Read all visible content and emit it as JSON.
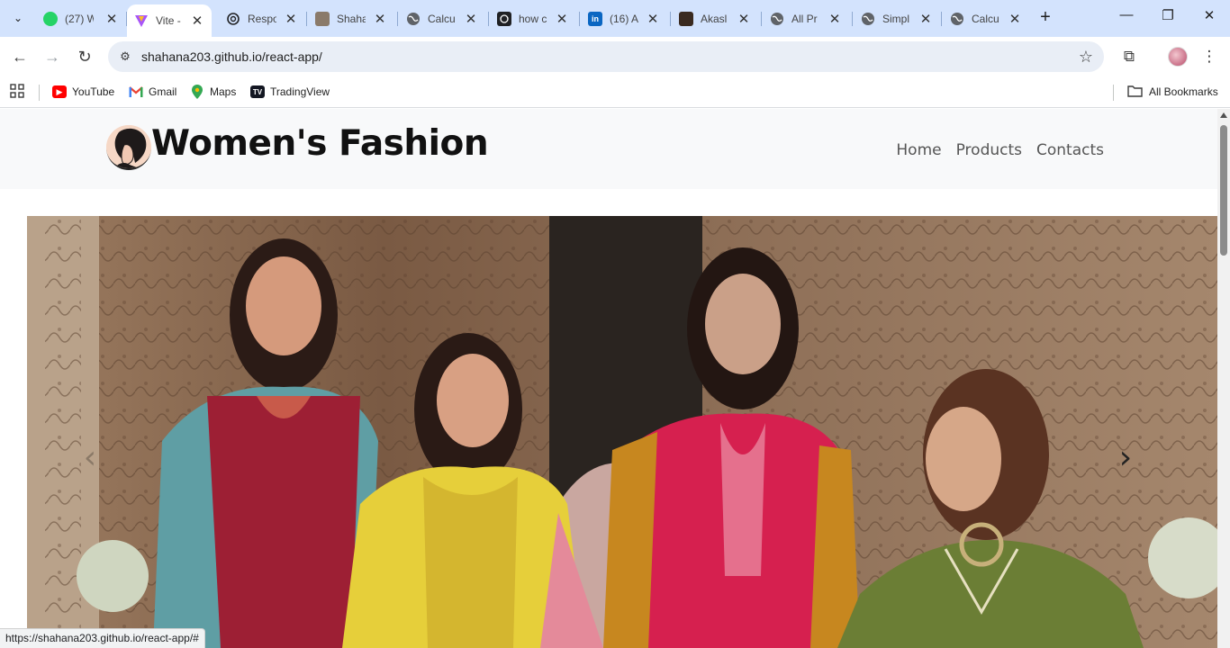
{
  "browser": {
    "tabs": [
      {
        "title": "(27) W",
        "icon": "whatsapp-icon",
        "color": "#25d366",
        "badge": "27"
      },
      {
        "title": "Vite -",
        "icon": "vite-icon",
        "color": "#a855f7",
        "active": true
      },
      {
        "title": "Respo",
        "icon": "openai-icon",
        "color": "#202124"
      },
      {
        "title": "Shaha",
        "icon": "github-avatar-icon",
        "color": "#8a7a6a"
      },
      {
        "title": "Calcu",
        "icon": "globe-icon",
        "color": "#5f6368"
      },
      {
        "title": "how c",
        "icon": "github-icon",
        "color": "#202124"
      },
      {
        "title": "(16) A",
        "icon": "linkedin-icon",
        "color": "#0a66c2",
        "badge": "in"
      },
      {
        "title": "Akasl",
        "icon": "profile-icon",
        "color": "#3a2a20"
      },
      {
        "title": "All Pr",
        "icon": "globe-icon",
        "color": "#5f6368"
      },
      {
        "title": "Simpl",
        "icon": "globe-icon",
        "color": "#5f6368"
      },
      {
        "title": "Calcu",
        "icon": "globe-icon",
        "color": "#5f6368"
      }
    ],
    "url": "shahana203.github.io/react-app/",
    "bookmarks": [
      {
        "label": "YouTube",
        "icon": "youtube-icon",
        "color": "#ff0000"
      },
      {
        "label": "Gmail",
        "icon": "gmail-icon",
        "color": "#ea4335"
      },
      {
        "label": "Maps",
        "icon": "maps-pin-icon",
        "color": "#34a853"
      },
      {
        "label": "TradingView",
        "icon": "tradingview-icon",
        "color": "#131722"
      }
    ],
    "all_bookmarks_label": "All Bookmarks",
    "status_url": "https://shahana203.github.io/react-app/#"
  },
  "site": {
    "brand": "Women's Fashion",
    "nav": [
      "Home",
      "Products",
      "Contacts"
    ],
    "carousel": {
      "prev_icon": "chevron-left-icon",
      "next_icon": "chevron-right-icon"
    }
  }
}
